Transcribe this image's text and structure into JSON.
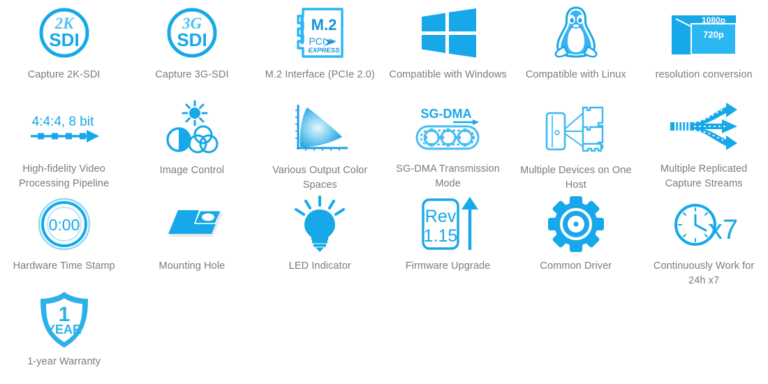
{
  "theme": {
    "accent": "#16a8e8",
    "accent_light": "#56c5f2",
    "accent_dark": "#0f8fd0",
    "label_color": "#7b7b7b",
    "background": "#ffffff"
  },
  "features": [
    {
      "id": "capture-2k-sdi",
      "label": "Capture 2K-SDI",
      "icon": "circle-2k-sdi-icon",
      "icon_text": [
        "2K",
        "SDI"
      ]
    },
    {
      "id": "capture-3g-sdi",
      "label": "Capture 3G-SDI",
      "icon": "circle-3g-sdi-icon",
      "icon_text": [
        "3G",
        "SDI"
      ]
    },
    {
      "id": "m2-interface",
      "label": "M.2 Interface (PCIe 2.0)",
      "icon": "m2-card-icon",
      "icon_text": [
        "M.2",
        "PCI",
        "EXPRESS"
      ]
    },
    {
      "id": "compatible-windows",
      "label": "Compatible with Windows",
      "icon": "windows-logo-icon",
      "icon_text": []
    },
    {
      "id": "compatible-linux",
      "label": "Compatible with Linux",
      "icon": "linux-penguin-icon",
      "icon_text": []
    },
    {
      "id": "resolution-conversion",
      "label": "resolution conversion",
      "icon": "resolution-scale-icon",
      "icon_text": [
        "1080p",
        "720p"
      ]
    },
    {
      "id": "video-pipeline",
      "label": "High-fidelity Video Processing Pipeline",
      "icon": "pipeline-arrow-icon",
      "icon_text": [
        "4:4:4, 8 bit"
      ]
    },
    {
      "id": "image-control",
      "label": "Image Control",
      "icon": "brightness-color-icon",
      "icon_text": []
    },
    {
      "id": "color-spaces",
      "label": "Various Output Color Spaces",
      "icon": "chromaticity-chart-icon",
      "icon_text": []
    },
    {
      "id": "sg-dma",
      "label": "SG-DMA Transmission Mode",
      "icon": "gear-chain-icon",
      "icon_text": [
        "SG-DMA"
      ]
    },
    {
      "id": "multiple-devices",
      "label": "Multiple Devices on One Host",
      "icon": "host-multi-card-icon",
      "icon_text": []
    },
    {
      "id": "replicated-streams",
      "label": "Multiple Replicated Capture Streams",
      "icon": "split-arrows-icon",
      "icon_text": []
    },
    {
      "id": "hardware-timestamp",
      "label": "Hardware Time Stamp",
      "icon": "stopwatch-icon",
      "icon_text": [
        "0:00"
      ]
    },
    {
      "id": "mounting-hole",
      "label": "Mounting Hole",
      "icon": "mounting-plate-icon",
      "icon_text": []
    },
    {
      "id": "led-indicator",
      "label": "LED Indicator",
      "icon": "lightbulb-icon",
      "icon_text": []
    },
    {
      "id": "firmware-upgrade",
      "label": "Firmware Upgrade",
      "icon": "firmware-rev-arrow-icon",
      "icon_text": [
        "Rev",
        "1.15"
      ]
    },
    {
      "id": "common-driver",
      "label": "Common Driver",
      "icon": "gear-icon",
      "icon_text": []
    },
    {
      "id": "continuous-work",
      "label": "Continuously Work for 24h x7",
      "icon": "clock-x7-icon",
      "icon_text": [
        "x7"
      ]
    },
    {
      "id": "warranty",
      "label": "1-year Warranty",
      "icon": "shield-warranty-icon",
      "icon_text": [
        "1",
        "YEAR"
      ]
    }
  ]
}
